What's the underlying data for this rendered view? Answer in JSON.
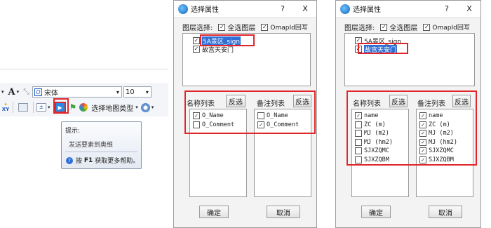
{
  "left": {
    "font_name": "宋体",
    "font_size": "10",
    "a_label": "A",
    "xy_label": "XY",
    "map_type_label": "选择地图类型",
    "tooltip": {
      "title": "提示:",
      "body": "发送要素到奥维",
      "help_key": "F1",
      "help_prefix": "按",
      "help_suffix": "获取更多帮助。"
    }
  },
  "dialogs": [
    {
      "title": "选择属性",
      "help": "?",
      "close": "X",
      "layer_select_label": "图层选择:",
      "all_layers_label": "全选图层",
      "writeback_label": "OmapId回写",
      "layers": [
        {
          "label": "5A景区_sign",
          "checked": true,
          "selected": true
        },
        {
          "label": "故宫天安门",
          "checked": true,
          "selected": false
        }
      ],
      "name_list_label": "名称列表",
      "name_invert_label": "反选",
      "note_list_label": "备注列表",
      "note_invert_label": "反选",
      "name_fields": [
        {
          "label": "O_Name",
          "checked": true
        },
        {
          "label": "O_Comment",
          "checked": false
        }
      ],
      "note_fields": [
        {
          "label": "O_Name",
          "checked": false
        },
        {
          "label": "O_Comment",
          "checked": true
        }
      ],
      "ok_label": "确定",
      "cancel_label": "取消"
    },
    {
      "title": "选择属性",
      "help": "?",
      "close": "X",
      "layer_select_label": "图层选择:",
      "all_layers_label": "全选图层",
      "writeback_label": "OmapId回写",
      "layers": [
        {
          "label": "5A景区_sign",
          "checked": true,
          "selected": false
        },
        {
          "label": "故宫天安门",
          "checked": true,
          "selected": true
        }
      ],
      "name_list_label": "名称列表",
      "name_invert_label": "反选",
      "note_list_label": "备注列表",
      "note_invert_label": "反选",
      "name_fields": [
        {
          "label": "name",
          "checked": true
        },
        {
          "label": "ZC (m)",
          "checked": false
        },
        {
          "label": "MJ (m2)",
          "checked": false
        },
        {
          "label": "MJ (hm2)",
          "checked": false
        },
        {
          "label": "SJXZQMC",
          "checked": false
        },
        {
          "label": "SJXZQBM",
          "checked": false
        }
      ],
      "note_fields": [
        {
          "label": "name",
          "checked": true
        },
        {
          "label": "ZC (m)",
          "checked": true
        },
        {
          "label": "MJ (m2)",
          "checked": true
        },
        {
          "label": "MJ (hm2)",
          "checked": true
        },
        {
          "label": "SJXZQMC",
          "checked": true
        },
        {
          "label": "SJXZQBM",
          "checked": true
        }
      ],
      "ok_label": "确定",
      "cancel_label": "取消"
    }
  ],
  "colors": {
    "highlight": "#e0262a",
    "selection": "#2f6fd6"
  }
}
